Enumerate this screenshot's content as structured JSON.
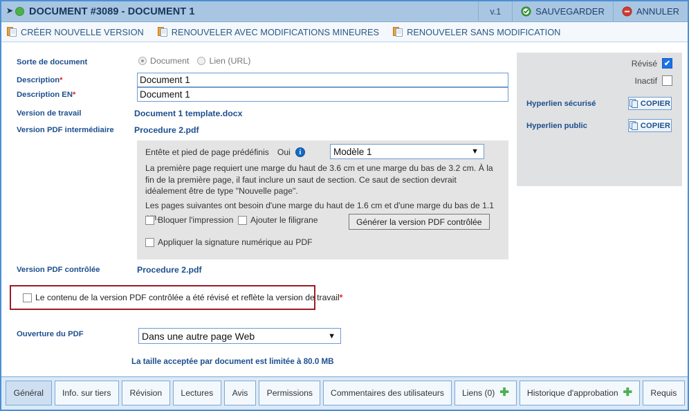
{
  "titlebar": {
    "expander_icon": "chevron-right-icon",
    "status_dot": "green-status-dot",
    "title": "DOCUMENT #3089 - DOCUMENT 1",
    "version": "v.1",
    "save_label": "SAUVEGARDER",
    "cancel_label": "ANNULER",
    "bg_color": "#a8c6e2",
    "title_color": "#16355c"
  },
  "actionbar": {
    "actions": [
      {
        "label": "CRÉER NOUVELLE VERSION",
        "icon": "document-copy-icon"
      },
      {
        "label": "RENOUVELER AVEC MODIFICATIONS MINEURES",
        "icon": "document-copy-icon"
      },
      {
        "label": "RENOUVELER SANS MODIFICATION",
        "icon": "document-copy-icon"
      }
    ]
  },
  "form": {
    "sorte_label": "Sorte de document",
    "radio_document": "Document",
    "radio_lien": "Lien (URL)",
    "description_label": "Description",
    "description_value": "Document 1",
    "description_en_label": "Description EN",
    "description_en_value": "Document 1",
    "version_travail_label": "Version de travail",
    "version_travail_value": "Document 1 template.docx",
    "version_pdf_inter_label": "Version PDF intermédiaire",
    "version_pdf_inter_value": "Procedure 2.pdf",
    "version_pdf_ctrl_label": "Version PDF contrôlée",
    "version_pdf_ctrl_value": "Procedure 2.pdf",
    "required_marker": "*"
  },
  "pdf_panel": {
    "header_label": "Entête et pied de page prédéfinis",
    "header_value": "Oui",
    "info_icon": "info-icon",
    "info_glyph": "i",
    "template_selected": "Modèle 1",
    "template_options": [
      "Modèle 1"
    ],
    "paragraph_1": "La première page requiert une marge du haut de 3.6 cm et une marge du bas de 3.2 cm. À la fin de la première page, il faut inclure un saut de section. Ce saut de section devrait idéalement être de type \"Nouvelle page\".",
    "paragraph_2": "Les pages suivantes ont besoin d'une marge du haut de 1.6 cm et d'une marge du bas de 1.1 cm.",
    "checkbox_bloquer": "Bloquer l'impression",
    "checkbox_filigrane": "Ajouter le filigrane",
    "checkbox_signature": "Appliquer la signature numérique au PDF",
    "generate_button": "Générer la version PDF contrôlée",
    "bg_color": "#e4e4e4"
  },
  "sidebar": {
    "revise_label": "Révisé",
    "revise_checked": true,
    "check_glyph": "✔",
    "inactif_label": "Inactif",
    "inactif_checked": false,
    "hyperlien_securise_label": "Hyperlien sécurisé",
    "hyperlien_public_label": "Hyperlien public",
    "copier_label": "COPIER",
    "copy_icon": "copy-pages-icon",
    "bg_color": "#e0e1e2",
    "accent_color": "#1a73e8"
  },
  "attestation": {
    "text": "Le contenu de la version PDF contrôlée a été révisé et reflète la version de travail",
    "required_marker": "*",
    "checked": false,
    "border_color": "#9c1b24"
  },
  "ouverture": {
    "label": "Ouverture du PDF",
    "selected": "Dans une autre page Web",
    "options": [
      "Dans une autre page Web"
    ],
    "size_note": "La taille acceptée par document est limitée à 80.0 MB"
  },
  "tabs": [
    {
      "label": "Général",
      "active": true,
      "plus": false
    },
    {
      "label": "Info. sur tiers",
      "active": false,
      "plus": false
    },
    {
      "label": "Révision",
      "active": false,
      "plus": false
    },
    {
      "label": "Lectures",
      "active": false,
      "plus": false
    },
    {
      "label": "Avis",
      "active": false,
      "plus": false
    },
    {
      "label": "Permissions",
      "active": false,
      "plus": false
    },
    {
      "label": "Commentaires des utilisateurs",
      "active": false,
      "plus": false
    },
    {
      "label": "Liens (0)",
      "active": false,
      "plus": true
    },
    {
      "label": "Historique d'approbation",
      "active": false,
      "plus": true
    },
    {
      "label": "Requis",
      "active": false,
      "plus": false
    }
  ],
  "plus_glyph": "✚"
}
